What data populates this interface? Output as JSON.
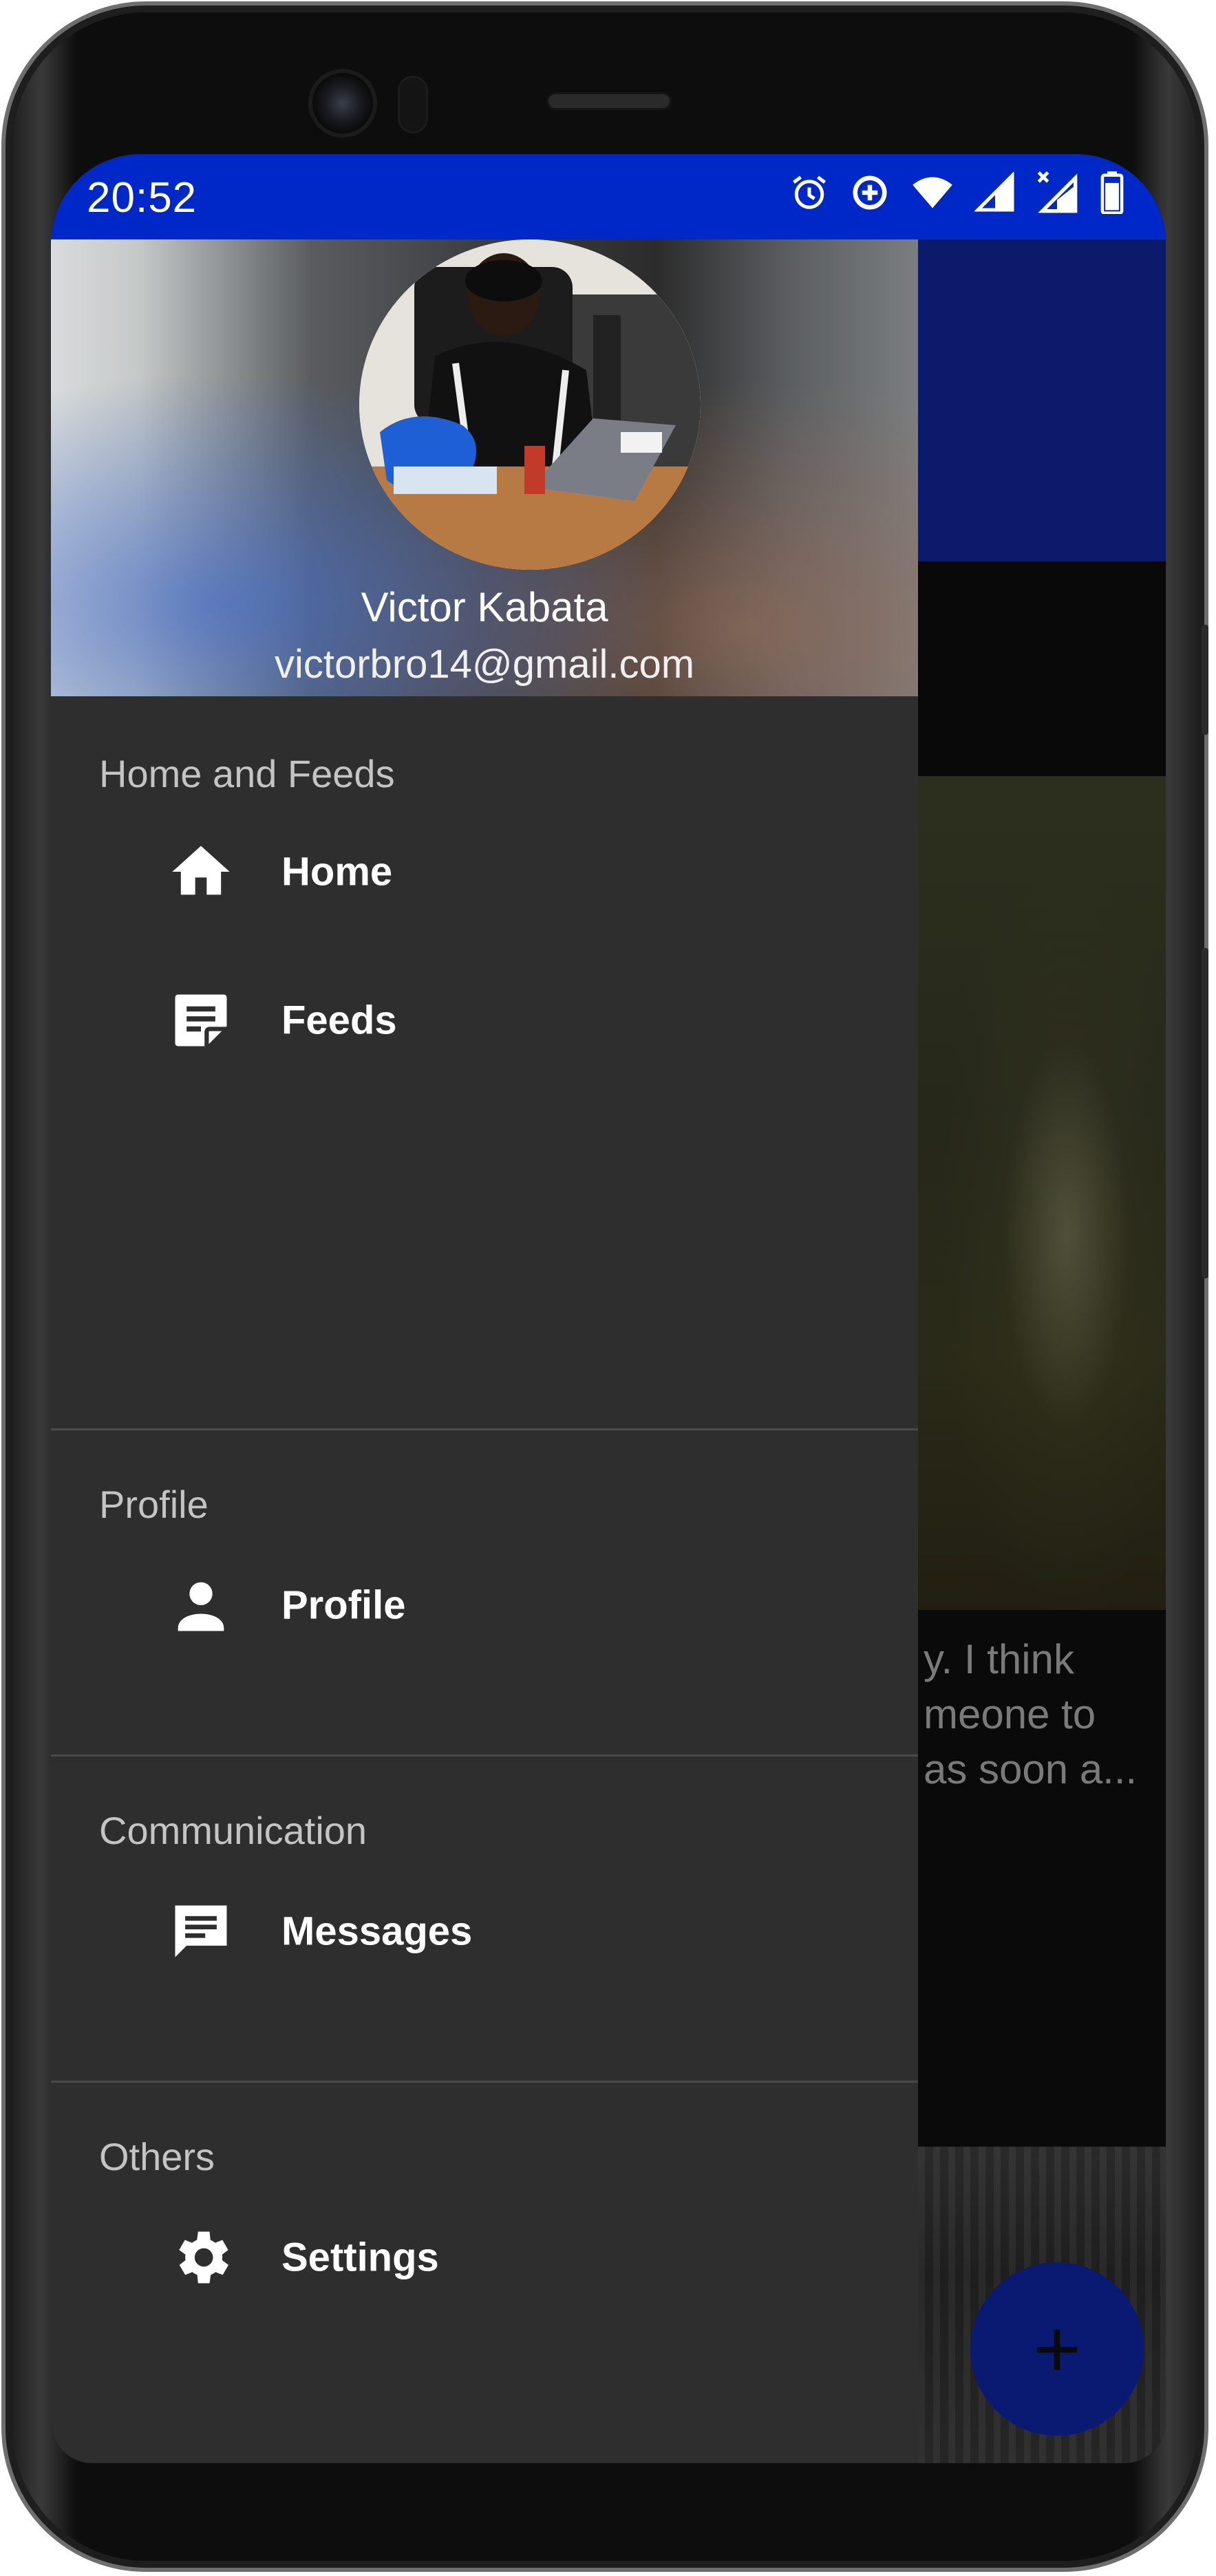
{
  "status_bar": {
    "time": "20:52",
    "icons": [
      "alarm-icon",
      "data-saver-icon",
      "wifi-icon",
      "signal-icon",
      "signal-no-data-icon",
      "battery-icon"
    ],
    "background": "#0028c8"
  },
  "drawer": {
    "header": {
      "user_name": "Victor Kabata",
      "user_email": "victorbro14@gmail.com"
    },
    "sections": [
      {
        "title": "Home and Feeds",
        "items": [
          {
            "label": "Home",
            "icon": "home-icon"
          },
          {
            "label": "Feeds",
            "icon": "feeds-icon"
          }
        ]
      },
      {
        "title": "Profile",
        "items": [
          {
            "label": "Profile",
            "icon": "person-icon"
          }
        ]
      },
      {
        "title": "Communication",
        "items": [
          {
            "label": "Messages",
            "icon": "message-icon"
          }
        ]
      },
      {
        "title": "Others",
        "items": [
          {
            "label": "Settings",
            "icon": "gear-icon"
          }
        ]
      }
    ],
    "background": "#2e2e2e"
  },
  "background_app": {
    "post_excerpt_lines": [
      "y. I think",
      "meone to",
      "as soon a..."
    ],
    "fab_label": "+",
    "accent": "#0a1a72"
  }
}
